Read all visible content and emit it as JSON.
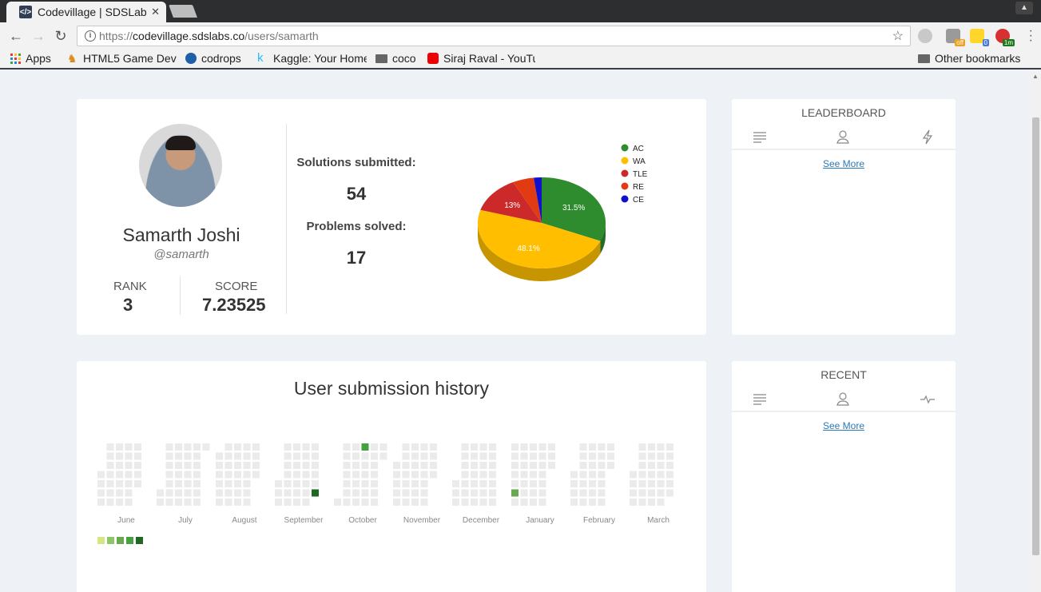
{
  "browser": {
    "tab_title": "Codevillage | SDSLabs",
    "url_scheme": "https://",
    "url_host": "codevillage.sdslabs.co",
    "url_path": "/users/samarth",
    "extensions": [
      {
        "name": "ext-1",
        "badge": ""
      },
      {
        "name": "ext-2",
        "badge": "off"
      },
      {
        "name": "ext-3",
        "badge": "0"
      },
      {
        "name": "ext-4",
        "badge": "1m"
      }
    ],
    "bookmarks": [
      "Apps",
      "HTML5 Game Dev",
      "codrops",
      "Kaggle: Your Home",
      "coco",
      "Siraj Raval - YouTube"
    ],
    "other_bookmarks": "Other bookmarks"
  },
  "profile": {
    "name": "Samarth Joshi",
    "handle": "@samarth",
    "rank_label": "RANK",
    "rank_value": "3",
    "score_label": "SCORE",
    "score_value": "7.23525",
    "solutions_label": "Solutions submitted:",
    "solutions_value": "54",
    "problems_label": "Problems solved:",
    "problems_value": "17"
  },
  "leaderboard": {
    "title": "LEADERBOARD",
    "see_more": "See More"
  },
  "recent": {
    "title": "RECENT",
    "see_more": "See More"
  },
  "history": {
    "title": "User submission history",
    "months": [
      "June",
      "July",
      "August",
      "September",
      "October",
      "November",
      "December",
      "January",
      "February",
      "March"
    ],
    "empty_color": "#ebebeb",
    "scale_colors": [
      "#d6e685",
      "#8cc665",
      "#6aa84f",
      "#44a340",
      "#1e6823"
    ],
    "highlighted_cells": [
      {
        "month": "September",
        "week": 4,
        "day": 5,
        "level": 4
      },
      {
        "month": "October",
        "week": 3,
        "day": 0,
        "level": 3
      },
      {
        "month": "January",
        "week": 0,
        "day": 5,
        "level": 2
      }
    ]
  },
  "chart_data": {
    "type": "pie",
    "title": "",
    "slices": [
      {
        "label": "AC",
        "value": 31.5,
        "color": "#2e8b2e",
        "text": "31.5%"
      },
      {
        "label": "WA",
        "value": 48.1,
        "color": "#ffbf00",
        "text": "48.1%"
      },
      {
        "label": "TLE",
        "value": 13.0,
        "color": "#cc2a2a",
        "text": "13%"
      },
      {
        "label": "RE",
        "value": 5.4,
        "color": "#e23b12",
        "text": ""
      },
      {
        "label": "CE",
        "value": 2.0,
        "color": "#1111cc",
        "text": ""
      }
    ],
    "legend_position": "right"
  }
}
